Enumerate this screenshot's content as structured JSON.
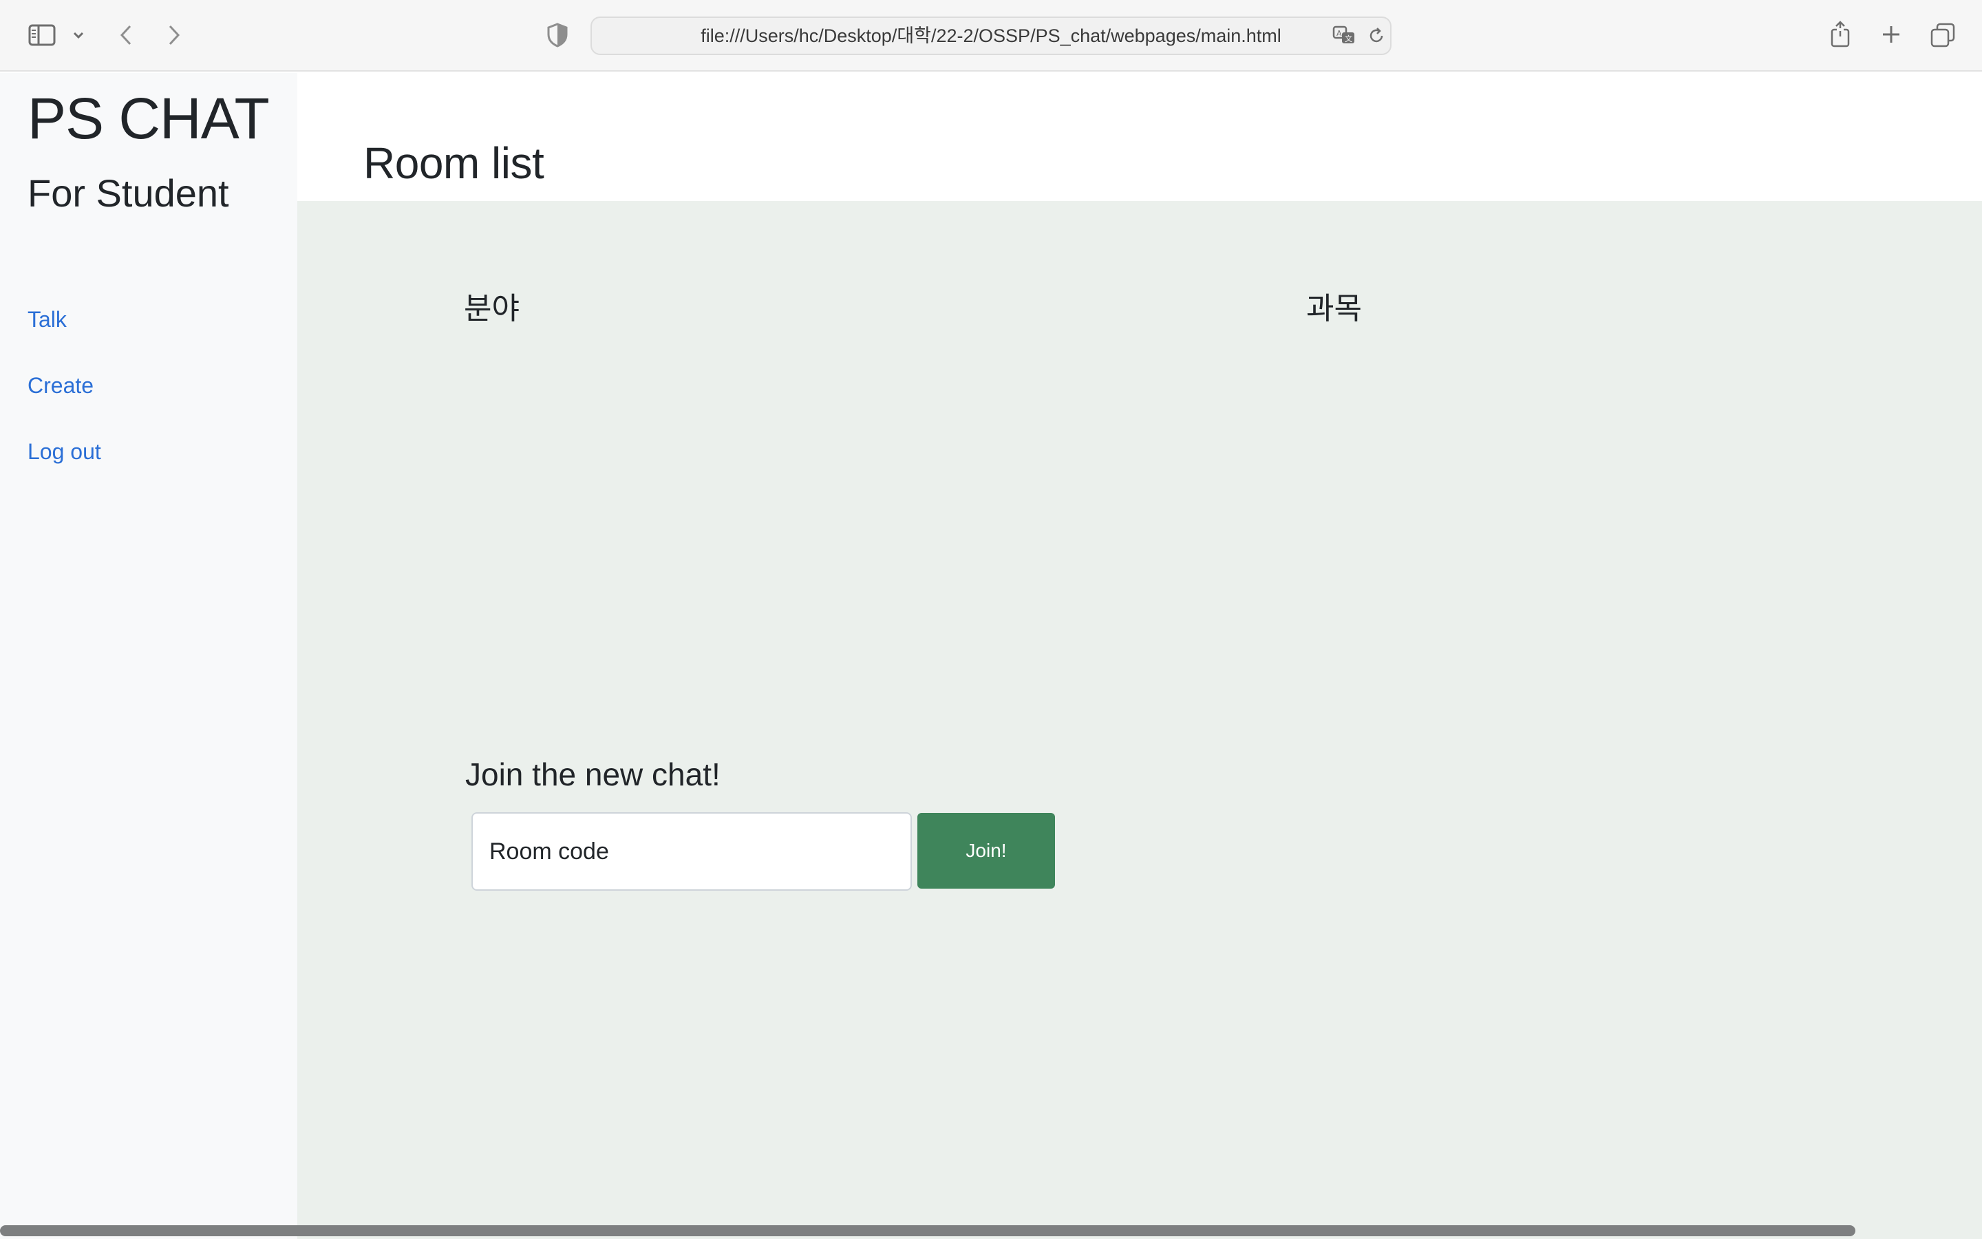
{
  "browser": {
    "url": "file:///Users/hc/Desktop/대학/22-2/OSSP/PS_chat/webpages/main.html",
    "icons": [
      "sidebar-toggle-icon",
      "chevron-down-icon",
      "back-arrow-icon",
      "forward-arrow-icon",
      "privacy-shield-icon",
      "translate-icon",
      "reload-icon",
      "share-icon",
      "new-tab-plus-icon",
      "tab-overview-icon"
    ]
  },
  "sidebar": {
    "brand": "PS CHAT",
    "subtitle": "For Student",
    "links": [
      {
        "label": "Talk"
      },
      {
        "label": "Create"
      },
      {
        "label": "Log out"
      }
    ],
    "link_color": "#2b6fd6"
  },
  "main": {
    "title": "Room list",
    "columns": [
      "분야",
      "과목"
    ],
    "join": {
      "heading": "Join the new chat!",
      "input_placeholder": "Room code",
      "button_label": "Join!",
      "button_color": "#3f855b"
    },
    "body_background": "#ebf0ec"
  }
}
